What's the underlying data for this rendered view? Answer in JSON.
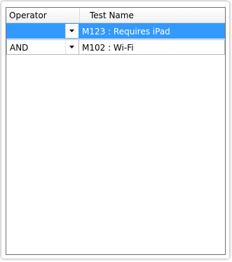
{
  "grid": {
    "columns": {
      "operator": "Operator",
      "test_name": "Test Name"
    },
    "rows": [
      {
        "operator": "",
        "test_name": "M123 : Requires iPad",
        "selected": true
      },
      {
        "operator": "AND",
        "test_name": "M102 : Wi-Fi",
        "selected": false
      }
    ]
  },
  "colors": {
    "selection": "#3399ff",
    "border": "#6f6f6f"
  },
  "icons": {
    "dropdown": "chevron-down-icon"
  }
}
